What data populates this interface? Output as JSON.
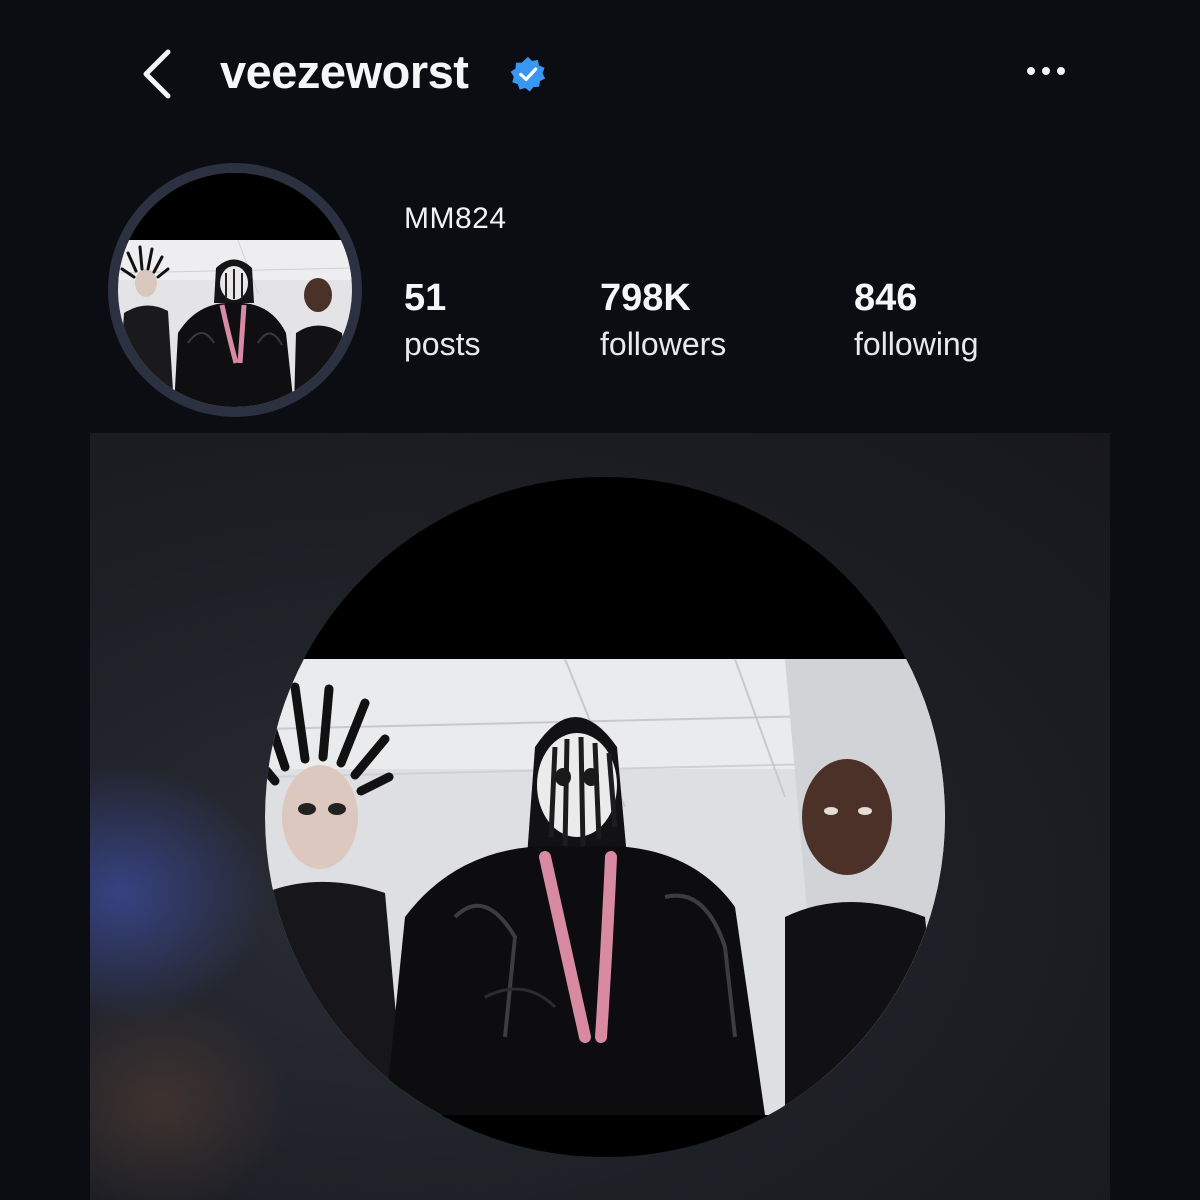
{
  "header": {
    "username": "veezeworst",
    "back_icon": "chevron-left-icon",
    "verified_icon": "verified-badge-icon",
    "more_icon": "more-horizontal-icon"
  },
  "profile": {
    "display_name": "MM824",
    "stats": {
      "posts": {
        "value": "51",
        "label": "posts"
      },
      "followers": {
        "value": "798K",
        "label": "followers"
      },
      "following": {
        "value": "846",
        "label": "following"
      }
    }
  },
  "colors": {
    "background": "#0b0d12",
    "verified": "#3897f0",
    "text": "#f5f6f8"
  }
}
